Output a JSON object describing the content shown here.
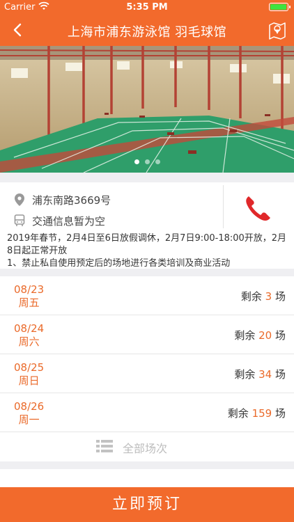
{
  "status": {
    "carrier": "Carrier",
    "time": "5:35 PM"
  },
  "nav": {
    "title": "上海市浦东游泳馆 羽毛球馆"
  },
  "venue": {
    "address": "浦东南路3669号",
    "transit": "交通信息暂为空",
    "notice": "2019年春节，2月4日至6日放假调休，2月7日9:00-18:00开放，2月8日起正常开放\n1、禁止私自使用预定后的场地进行各类培训及商业活动"
  },
  "schedule": {
    "remain_prefix": "剩余",
    "remain_suffix": "场",
    "days": [
      {
        "date": "08/23",
        "weekday": "周五",
        "count": "3"
      },
      {
        "date": "08/24",
        "weekday": "周六",
        "count": "20"
      },
      {
        "date": "08/25",
        "weekday": "周日",
        "count": "34"
      },
      {
        "date": "08/26",
        "weekday": "周一",
        "count": "159"
      }
    ],
    "all_label": "全部场次"
  },
  "book_label": "立即预订",
  "colors": {
    "accent": "#f26a2c",
    "highlight": "#ea6a2a",
    "court": "#2f9e6a"
  }
}
